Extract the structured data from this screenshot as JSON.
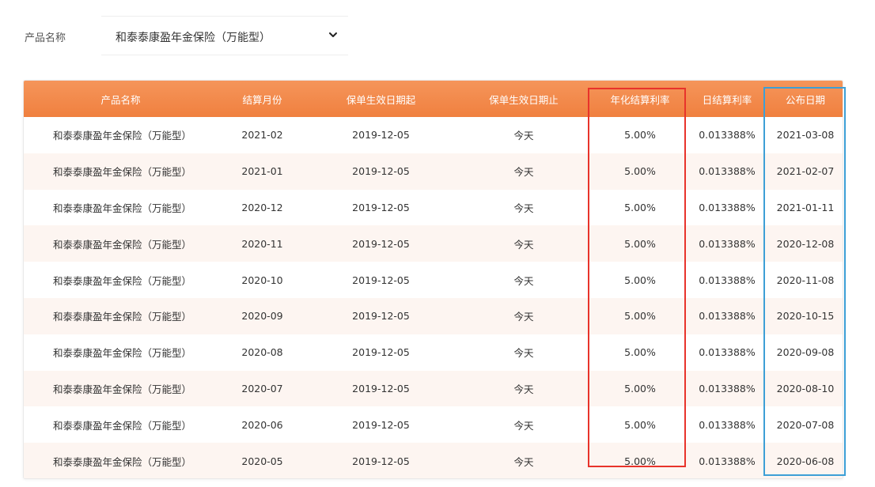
{
  "filter": {
    "label": "产品名称",
    "selected": "和泰泰康盈年金保险（万能型）"
  },
  "table": {
    "headers": [
      "产品名称",
      "结算月份",
      "保单生效日期起",
      "保单生效日期止",
      "年化结算利率",
      "日结算利率",
      "公布日期"
    ],
    "rows": [
      [
        "和泰泰康盈年金保险（万能型）",
        "2021-02",
        "2019-12-05",
        "今天",
        "5.00%",
        "0.013388%",
        "2021-03-08"
      ],
      [
        "和泰泰康盈年金保险（万能型）",
        "2021-01",
        "2019-12-05",
        "今天",
        "5.00%",
        "0.013388%",
        "2021-02-07"
      ],
      [
        "和泰泰康盈年金保险（万能型）",
        "2020-12",
        "2019-12-05",
        "今天",
        "5.00%",
        "0.013388%",
        "2021-01-11"
      ],
      [
        "和泰泰康盈年金保险（万能型）",
        "2020-11",
        "2019-12-05",
        "今天",
        "5.00%",
        "0.013388%",
        "2020-12-08"
      ],
      [
        "和泰泰康盈年金保险（万能型）",
        "2020-10",
        "2019-12-05",
        "今天",
        "5.00%",
        "0.013388%",
        "2020-11-08"
      ],
      [
        "和泰泰康盈年金保险（万能型）",
        "2020-09",
        "2019-12-05",
        "今天",
        "5.00%",
        "0.013388%",
        "2020-10-15"
      ],
      [
        "和泰泰康盈年金保险（万能型）",
        "2020-08",
        "2019-12-05",
        "今天",
        "5.00%",
        "0.013388%",
        "2020-09-08"
      ],
      [
        "和泰泰康盈年金保险（万能型）",
        "2020-07",
        "2019-12-05",
        "今天",
        "5.00%",
        "0.013388%",
        "2020-08-10"
      ],
      [
        "和泰泰康盈年金保险（万能型）",
        "2020-06",
        "2019-12-05",
        "今天",
        "5.00%",
        "0.013388%",
        "2020-07-08"
      ],
      [
        "和泰泰康盈年金保险（万能型）",
        "2020-05",
        "2019-12-05",
        "今天",
        "5.00%",
        "0.013388%",
        "2020-06-08"
      ]
    ]
  },
  "colors": {
    "header_bg": "#f0803f",
    "highlight_red": "#e8332b",
    "highlight_blue": "#3d9fd6"
  },
  "icons": {
    "select_toggle": "chevron-down-icon"
  }
}
